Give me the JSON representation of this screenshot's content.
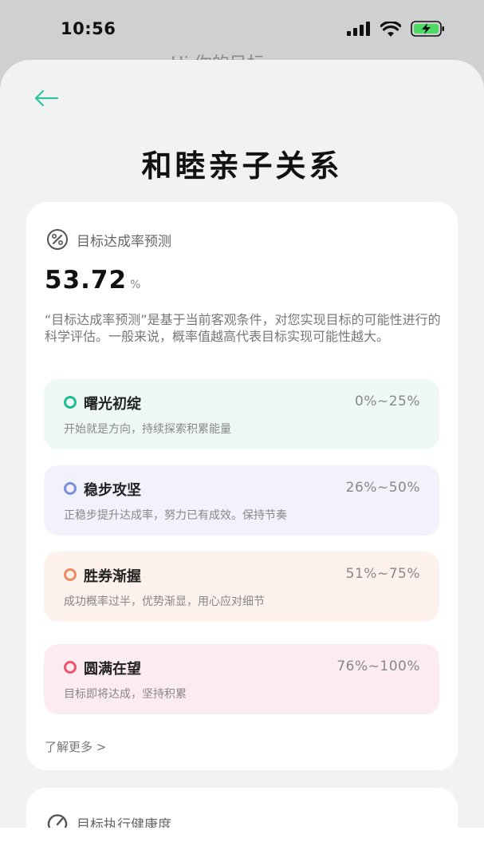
{
  "status_bar": {
    "time": "10:56",
    "icons": [
      "signal-icon",
      "wifi-icon",
      "battery-charging-icon"
    ],
    "battery_color": "#4cd964"
  },
  "background_page": {
    "partial_title": "Hi 你的目标"
  },
  "header": {
    "back_icon": "arrow-left-icon",
    "back_color": "#2ec4a0",
    "title": "和睦亲子关系"
  },
  "prediction_card": {
    "icon": "percent-icon",
    "label": "目标达成率预测",
    "rate_value": "53.72",
    "rate_unit": "%",
    "description": "“目标达成率预测”是基于当前客观条件，对您实现目标的可能性进行的科学评估。一般来说，概率值越高代表目标实现可能性越大。",
    "levels": [
      {
        "name": "曙光初绽",
        "range": "0%~25%",
        "desc": "开始就是方向，持续探索积累能量",
        "color": "#1fbf8f",
        "bg": "#eef8f4"
      },
      {
        "name": "稳步攻坚",
        "range": "26%~50%",
        "desc": "正稳步提升达成率，努力已有成效。保持节奏",
        "color": "#7f8fe0",
        "bg": "#f1f2fc"
      },
      {
        "name": "胜券渐握",
        "range": "51%~75%",
        "desc": "成功概率过半，优势渐显，用心应对细节",
        "color": "#f08a5d",
        "bg": "#fdf1ec"
      },
      {
        "name": "圆满在望",
        "range": "76%~100%",
        "desc": "目标即将达成，坚持积累",
        "color": "#e9566f",
        "bg": "#fdecef"
      }
    ],
    "learn_more": "了解更多 >"
  },
  "health_card": {
    "icon": "gauge-icon",
    "label": "目标执行健康度"
  }
}
